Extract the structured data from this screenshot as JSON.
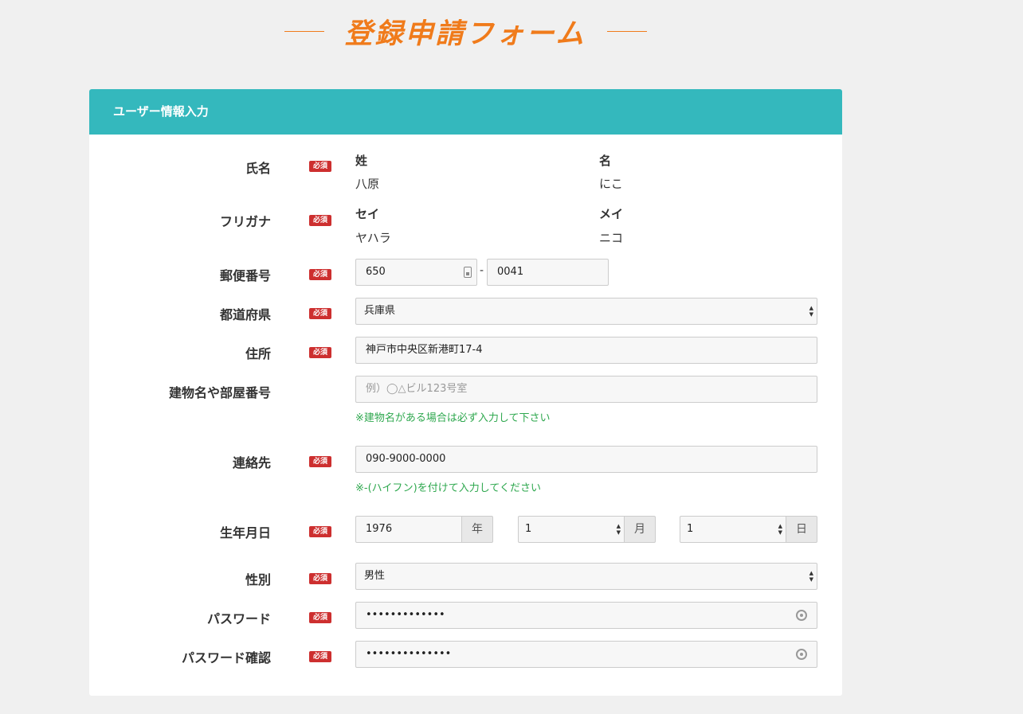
{
  "page_title": "登録申請フォーム",
  "section_title": "ユーザー情報入力",
  "required_badge": "必須",
  "colors": {
    "title_orange": "#f07b1b",
    "header_teal": "#34b8bd",
    "required_red": "#cd2f2f",
    "hint_green": "#2fa84f"
  },
  "fields": {
    "name": {
      "label": "氏名",
      "last_label": "姓",
      "last_value": "八原",
      "first_label": "名",
      "first_value": "にこ"
    },
    "kana": {
      "label": "フリガナ",
      "last_label": "セイ",
      "last_value": "ヤハラ",
      "first_label": "メイ",
      "first_value": "ニコ"
    },
    "postal": {
      "label": "郵便番号",
      "part1": "650",
      "separator": "-",
      "part2": "0041"
    },
    "prefecture": {
      "label": "都道府県",
      "value": "兵庫県"
    },
    "address": {
      "label": "住所",
      "value": "神戸市中央区新港町17-4"
    },
    "building": {
      "label": "建物名や部屋番号",
      "placeholder": "例）◯△ビル123号室",
      "hint": "※建物名がある場合は必ず入力して下さい"
    },
    "contact": {
      "label": "連絡先",
      "value": "090-9000-0000",
      "hint": "※-(ハイフン)を付けて入力してください"
    },
    "birthday": {
      "label": "生年月日",
      "year": "1976",
      "year_unit": "年",
      "month": "1",
      "month_unit": "月",
      "day": "1",
      "day_unit": "日"
    },
    "gender": {
      "label": "性別",
      "value": "男性"
    },
    "password": {
      "label": "パスワード",
      "value": "•••••••••••••"
    },
    "password_confirm": {
      "label": "パスワード確認",
      "value": "••••••••••••••"
    }
  }
}
